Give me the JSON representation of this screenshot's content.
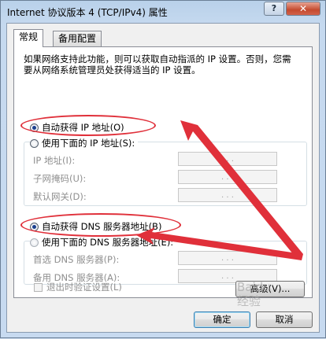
{
  "window": {
    "title": "Internet 协议版本 4 (TCP/IPv4) 属性",
    "help_label": "?",
    "close_label": "✕"
  },
  "tabs": [
    {
      "label": "常规",
      "active": true
    },
    {
      "label": "备用配置",
      "active": false
    }
  ],
  "description": "如果网络支持此功能，则可以获取自动指派的 IP 设置。否则，您需要从网络系统管理员处获得适当的 IP 设置。",
  "ip_section": {
    "auto_label": "自动获得 IP 地址(O)",
    "auto_selected": true,
    "manual_label": "使用下面的 IP 地址(S):",
    "fields": [
      {
        "label": "IP 地址(I):",
        "value": ". . ."
      },
      {
        "label": "子网掩码(U):",
        "value": ". . ."
      },
      {
        "label": "默认网关(D):",
        "value": ". . ."
      }
    ]
  },
  "dns_section": {
    "auto_label": "自动获得 DNS 服务器地址(B)",
    "auto_selected": true,
    "manual_label": "使用下面的 DNS 服务器地址(E):",
    "fields": [
      {
        "label": "首选 DNS 服务器(P):",
        "value": ". . ."
      },
      {
        "label": "备用 DNS 服务器(A):",
        "value": ". . ."
      }
    ]
  },
  "validate_checkbox": {
    "label": "退出时验证设置(L)",
    "checked": false
  },
  "buttons": {
    "advanced": "高级(V)...",
    "ok": "确定",
    "cancel": "取消"
  },
  "watermark": {
    "line1": "Baidu",
    "line2": "经验"
  },
  "colors": {
    "annotation_red": "#e0303a",
    "titlebar": "#b9d1ea",
    "close_button": "#c44a2e"
  }
}
